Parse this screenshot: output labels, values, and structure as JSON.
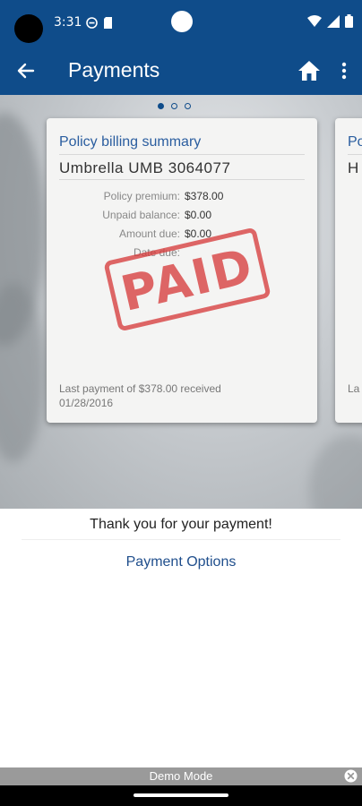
{
  "status_bar": {
    "time": "3:31"
  },
  "app_bar": {
    "title": "Payments"
  },
  "carousel": {
    "total_pages": 3,
    "active_page": 1
  },
  "card": {
    "heading": "Policy billing summary",
    "policy": "Umbrella UMB 3064077",
    "rows": [
      {
        "label": "Policy premium:",
        "value": "$378.00"
      },
      {
        "label": "Unpaid balance:",
        "value": "$0.00"
      },
      {
        "label": "Amount due:",
        "value": "$0.00"
      },
      {
        "label": "Date due:",
        "value": ""
      }
    ],
    "stamp": "PAID",
    "last_payment": "Last payment of $378.00 received 01/28/2016"
  },
  "next_card": {
    "heading": "Po",
    "policy": "H",
    "last_payment_fragment": "La"
  },
  "thanks_text": "Thank you for your payment!",
  "payment_options_label": "Payment Options",
  "demo_banner": {
    "label": "Demo Mode"
  },
  "colors": {
    "brand_blue": "#0f4c8a",
    "link_blue": "#1f4e8c",
    "stamp_red": "#d63c3c"
  },
  "icons": {
    "back": "arrow-left-icon",
    "home": "home-icon",
    "menu": "more-vert-icon",
    "close": "close-circle-icon"
  }
}
